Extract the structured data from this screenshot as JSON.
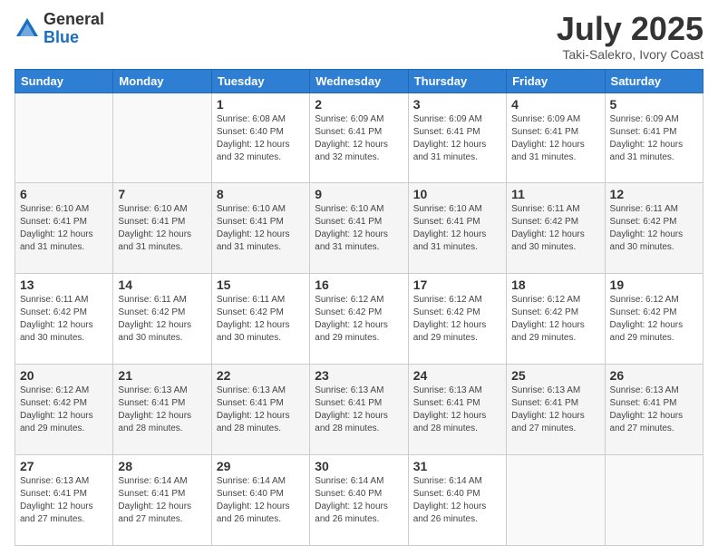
{
  "logo": {
    "general": "General",
    "blue": "Blue"
  },
  "title": "July 2025",
  "location": "Taki-Salekro, Ivory Coast",
  "days_of_week": [
    "Sunday",
    "Monday",
    "Tuesday",
    "Wednesday",
    "Thursday",
    "Friday",
    "Saturday"
  ],
  "weeks": [
    [
      {
        "day": "",
        "info": ""
      },
      {
        "day": "",
        "info": ""
      },
      {
        "day": "1",
        "info": "Sunrise: 6:08 AM\nSunset: 6:40 PM\nDaylight: 12 hours and 32 minutes."
      },
      {
        "day": "2",
        "info": "Sunrise: 6:09 AM\nSunset: 6:41 PM\nDaylight: 12 hours and 32 minutes."
      },
      {
        "day": "3",
        "info": "Sunrise: 6:09 AM\nSunset: 6:41 PM\nDaylight: 12 hours and 31 minutes."
      },
      {
        "day": "4",
        "info": "Sunrise: 6:09 AM\nSunset: 6:41 PM\nDaylight: 12 hours and 31 minutes."
      },
      {
        "day": "5",
        "info": "Sunrise: 6:09 AM\nSunset: 6:41 PM\nDaylight: 12 hours and 31 minutes."
      }
    ],
    [
      {
        "day": "6",
        "info": "Sunrise: 6:10 AM\nSunset: 6:41 PM\nDaylight: 12 hours and 31 minutes."
      },
      {
        "day": "7",
        "info": "Sunrise: 6:10 AM\nSunset: 6:41 PM\nDaylight: 12 hours and 31 minutes."
      },
      {
        "day": "8",
        "info": "Sunrise: 6:10 AM\nSunset: 6:41 PM\nDaylight: 12 hours and 31 minutes."
      },
      {
        "day": "9",
        "info": "Sunrise: 6:10 AM\nSunset: 6:41 PM\nDaylight: 12 hours and 31 minutes."
      },
      {
        "day": "10",
        "info": "Sunrise: 6:10 AM\nSunset: 6:41 PM\nDaylight: 12 hours and 31 minutes."
      },
      {
        "day": "11",
        "info": "Sunrise: 6:11 AM\nSunset: 6:42 PM\nDaylight: 12 hours and 30 minutes."
      },
      {
        "day": "12",
        "info": "Sunrise: 6:11 AM\nSunset: 6:42 PM\nDaylight: 12 hours and 30 minutes."
      }
    ],
    [
      {
        "day": "13",
        "info": "Sunrise: 6:11 AM\nSunset: 6:42 PM\nDaylight: 12 hours and 30 minutes."
      },
      {
        "day": "14",
        "info": "Sunrise: 6:11 AM\nSunset: 6:42 PM\nDaylight: 12 hours and 30 minutes."
      },
      {
        "day": "15",
        "info": "Sunrise: 6:11 AM\nSunset: 6:42 PM\nDaylight: 12 hours and 30 minutes."
      },
      {
        "day": "16",
        "info": "Sunrise: 6:12 AM\nSunset: 6:42 PM\nDaylight: 12 hours and 29 minutes."
      },
      {
        "day": "17",
        "info": "Sunrise: 6:12 AM\nSunset: 6:42 PM\nDaylight: 12 hours and 29 minutes."
      },
      {
        "day": "18",
        "info": "Sunrise: 6:12 AM\nSunset: 6:42 PM\nDaylight: 12 hours and 29 minutes."
      },
      {
        "day": "19",
        "info": "Sunrise: 6:12 AM\nSunset: 6:42 PM\nDaylight: 12 hours and 29 minutes."
      }
    ],
    [
      {
        "day": "20",
        "info": "Sunrise: 6:12 AM\nSunset: 6:42 PM\nDaylight: 12 hours and 29 minutes."
      },
      {
        "day": "21",
        "info": "Sunrise: 6:13 AM\nSunset: 6:41 PM\nDaylight: 12 hours and 28 minutes."
      },
      {
        "day": "22",
        "info": "Sunrise: 6:13 AM\nSunset: 6:41 PM\nDaylight: 12 hours and 28 minutes."
      },
      {
        "day": "23",
        "info": "Sunrise: 6:13 AM\nSunset: 6:41 PM\nDaylight: 12 hours and 28 minutes."
      },
      {
        "day": "24",
        "info": "Sunrise: 6:13 AM\nSunset: 6:41 PM\nDaylight: 12 hours and 28 minutes."
      },
      {
        "day": "25",
        "info": "Sunrise: 6:13 AM\nSunset: 6:41 PM\nDaylight: 12 hours and 27 minutes."
      },
      {
        "day": "26",
        "info": "Sunrise: 6:13 AM\nSunset: 6:41 PM\nDaylight: 12 hours and 27 minutes."
      }
    ],
    [
      {
        "day": "27",
        "info": "Sunrise: 6:13 AM\nSunset: 6:41 PM\nDaylight: 12 hours and 27 minutes."
      },
      {
        "day": "28",
        "info": "Sunrise: 6:14 AM\nSunset: 6:41 PM\nDaylight: 12 hours and 27 minutes."
      },
      {
        "day": "29",
        "info": "Sunrise: 6:14 AM\nSunset: 6:40 PM\nDaylight: 12 hours and 26 minutes."
      },
      {
        "day": "30",
        "info": "Sunrise: 6:14 AM\nSunset: 6:40 PM\nDaylight: 12 hours and 26 minutes."
      },
      {
        "day": "31",
        "info": "Sunrise: 6:14 AM\nSunset: 6:40 PM\nDaylight: 12 hours and 26 minutes."
      },
      {
        "day": "",
        "info": ""
      },
      {
        "day": "",
        "info": ""
      }
    ]
  ]
}
